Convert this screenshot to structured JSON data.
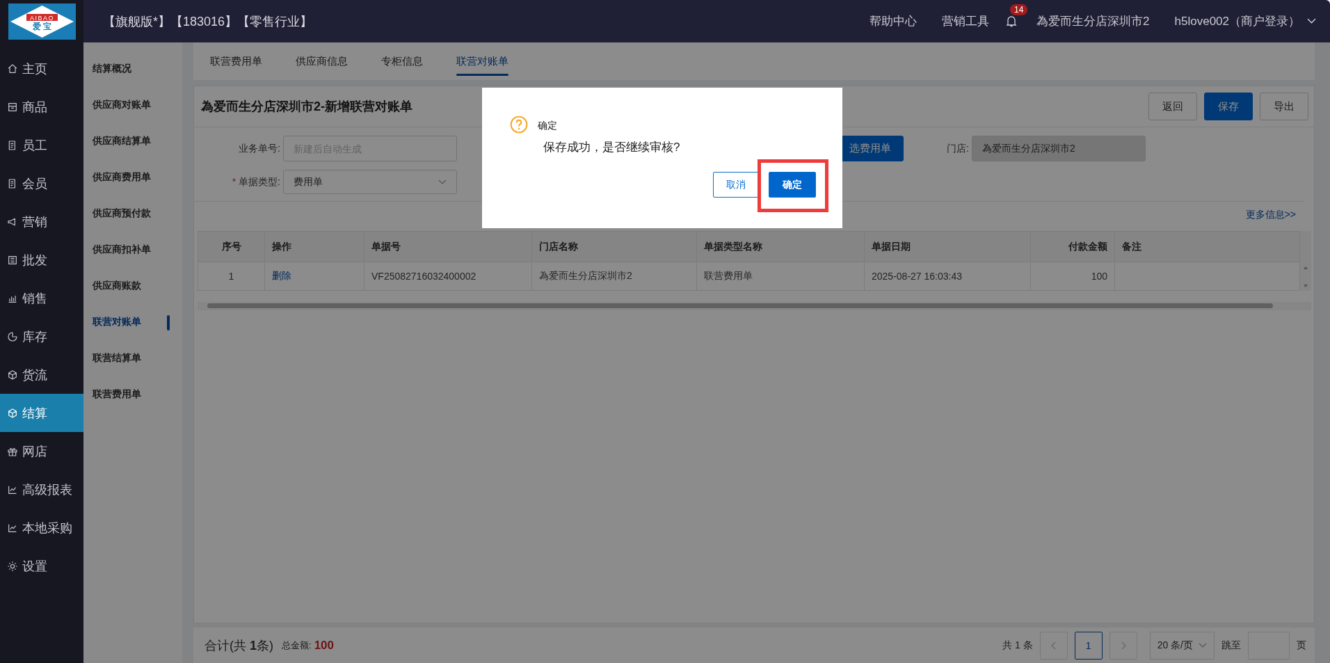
{
  "logo": {
    "brand": "AIBAO",
    "brand_cn": "爱 宝"
  },
  "header": {
    "edition": "【旗舰版*】【183016】【零售行业】",
    "links": [
      "帮助中心",
      "营销工具"
    ],
    "notifications": "14",
    "store": "為爱而生分店深圳市2",
    "user": "h5love002（商户登录）"
  },
  "nav": [
    {
      "label": "主页",
      "selected": false
    },
    {
      "label": "商品",
      "selected": false
    },
    {
      "label": "员工",
      "selected": false
    },
    {
      "label": "会员",
      "selected": false
    },
    {
      "label": "营销",
      "selected": false
    },
    {
      "label": "批发",
      "selected": false
    },
    {
      "label": "销售",
      "selected": false
    },
    {
      "label": "库存",
      "selected": false
    },
    {
      "label": "货流",
      "selected": false
    },
    {
      "label": "结算",
      "selected": true
    },
    {
      "label": "网店",
      "selected": false
    },
    {
      "label": "高级报表",
      "selected": false
    },
    {
      "label": "本地采购",
      "selected": false
    },
    {
      "label": "设置",
      "selected": false
    }
  ],
  "subnav": [
    {
      "label": "结算概况",
      "selected": false
    },
    {
      "label": "供应商对账单",
      "selected": false
    },
    {
      "label": "供应商结算单",
      "selected": false
    },
    {
      "label": "供应商费用单",
      "selected": false
    },
    {
      "label": "供应商预付款",
      "selected": false
    },
    {
      "label": "供应商扣补单",
      "selected": false
    },
    {
      "label": "供应商账款",
      "selected": false
    },
    {
      "label": "联营对账单",
      "selected": true
    },
    {
      "label": "联营结算单",
      "selected": false
    },
    {
      "label": "联营费用单",
      "selected": false
    }
  ],
  "tabs": [
    {
      "label": "联营费用单",
      "selected": false
    },
    {
      "label": "供应商信息",
      "selected": false
    },
    {
      "label": "专柜信息",
      "selected": false
    },
    {
      "label": "联营对账单",
      "selected": true
    }
  ],
  "page": {
    "title": "為爱而生分店深圳市2-新增联营对账单",
    "buttons": [
      {
        "label": "返回",
        "kind": "default"
      },
      {
        "label": "保存",
        "kind": "primary"
      },
      {
        "label": "导出",
        "kind": "default"
      }
    ],
    "fields": [
      {
        "label": "业务单号:",
        "placeholder": "新建后自动生成",
        "kind": "input"
      },
      {
        "label": "单据类型:",
        "value": "费用单",
        "required_mark": "*",
        "kind": "select"
      }
    ],
    "pick_button": "选费用单",
    "store_field": {
      "label": "门店:",
      "value": "為爱而生分店深圳市2",
      "disabled": true
    },
    "more_link": "更多信息>>"
  },
  "table": {
    "columns": [
      {
        "label": "序号",
        "kind": "index"
      },
      {
        "label": "操作",
        "kind": "link"
      },
      {
        "label": "单据号",
        "kind": "text"
      },
      {
        "label": "门店名称",
        "kind": "text"
      },
      {
        "label": "单据类型名称",
        "kind": "text"
      },
      {
        "label": "单据日期",
        "kind": "text"
      },
      {
        "label": "付款金额",
        "kind": "amount"
      },
      {
        "label": "备注",
        "kind": "text"
      }
    ],
    "rows": [
      {
        "cells": [
          "1",
          "删除",
          "VF25082716032400002",
          "為爱而生分店深圳市2",
          "联营费用单",
          "2025-08-27 16:03:43",
          "100"
        ]
      }
    ]
  },
  "footer": {
    "summary": "合计(共 **1**条)",
    "total_label": "总金额:",
    "total": "100",
    "count": "共 1 条",
    "pages": [
      {
        "label": "1",
        "selected": true
      }
    ],
    "page_size": "20 条/页",
    "jump_label": "跳至",
    "jump_suffix": "页"
  },
  "dialog": {
    "title": "确定",
    "message": "保存成功，是否继续审核?",
    "buttons": [
      {
        "label": "取消",
        "kind": "default",
        "highlighted": false
      },
      {
        "label": "确定",
        "kind": "primary",
        "highlighted": true
      }
    ]
  }
}
